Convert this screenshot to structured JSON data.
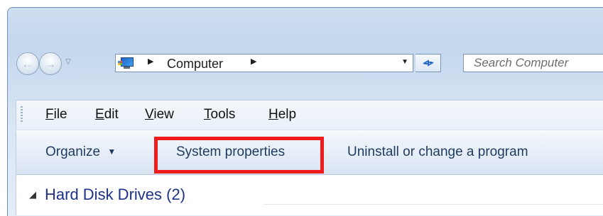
{
  "nav": {
    "back_icon": "back-arrow-icon",
    "forward_icon": "forward-arrow-icon",
    "recent_icon": "chevron-down-icon"
  },
  "address_bar": {
    "location_icon": "computer-icon",
    "breadcrumb": "Computer",
    "separator_icon": "chevron-right-icon",
    "dropdown_icon": "chevron-down-icon",
    "refresh_icon": "refresh-icon"
  },
  "search": {
    "placeholder": "Search Computer"
  },
  "menu": {
    "items": [
      {
        "accel": "F",
        "rest": "ile"
      },
      {
        "accel": "E",
        "rest": "dit"
      },
      {
        "accel": "V",
        "rest": "iew"
      },
      {
        "accel": "T",
        "rest": "ools"
      },
      {
        "accel": "H",
        "rest": "elp"
      }
    ]
  },
  "command_bar": {
    "organize_label": "Organize",
    "organize_dropdown_icon": "chevron-down-icon",
    "system_properties_label": "System properties",
    "uninstall_label": "Uninstall or change a program"
  },
  "annotation": {
    "highlight_color": "#ee1c1c",
    "highlighted": "System properties"
  },
  "content": {
    "group_header": "Hard Disk Drives (2)",
    "group_toggle_icon": "collapse-triangle-icon"
  }
}
